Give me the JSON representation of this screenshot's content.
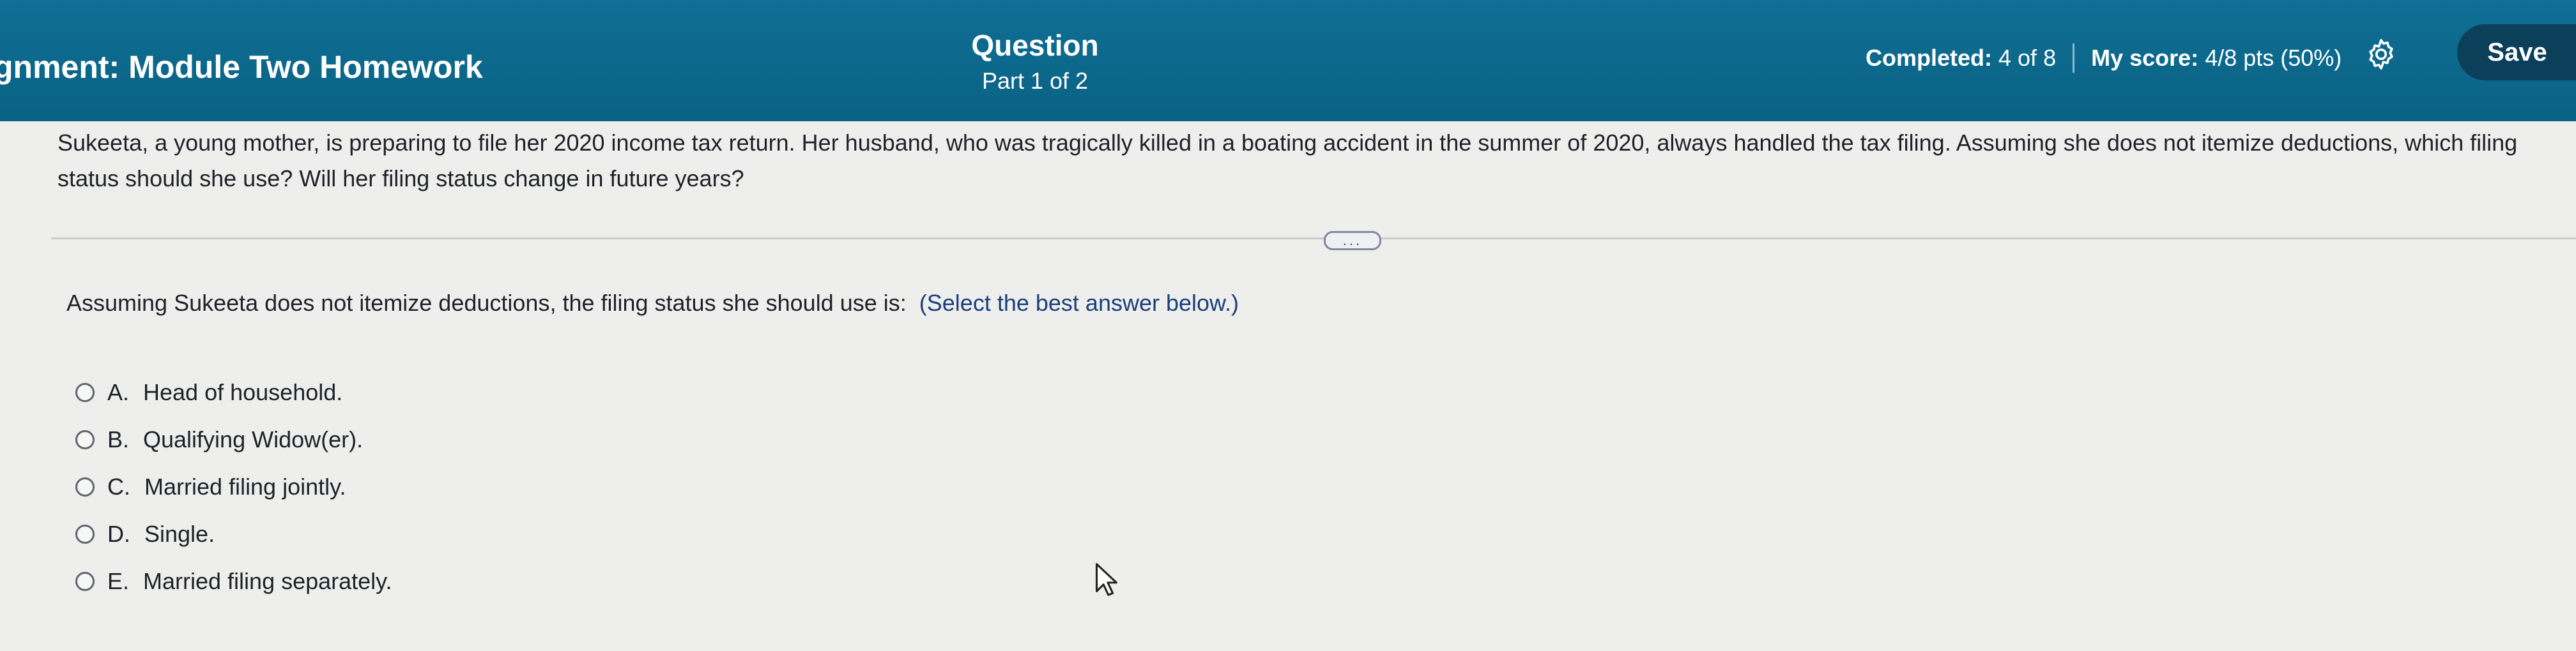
{
  "header": {
    "assignment_title": "gnment: Module Two Homework",
    "question_label": "Question",
    "part_label": "Part 1 of 2",
    "completed_label": "Completed:",
    "completed_value": "4 of 8",
    "score_label": "My score:",
    "score_value": "4/8 pts (50%)",
    "save_label": "Save"
  },
  "question": {
    "text": "Sukeeta, a young mother, is preparing to file her 2020 income tax return. Her husband, who was tragically killed in a boating accident in the summer of 2020, always handled the tax filing. Assuming she does not itemize deductions, which filing status should she use? Will her filing status change in future years?"
  },
  "expand": {
    "label": "..."
  },
  "prompt": {
    "text": "Assuming Sukeeta does not itemize deductions, the filing status she should use is:",
    "hint": "(Select the best answer below.)"
  },
  "options": [
    {
      "letter": "A.",
      "label": "Head of household."
    },
    {
      "letter": "B.",
      "label": "Qualifying Widow(er)."
    },
    {
      "letter": "C.",
      "label": "Married filing jointly."
    },
    {
      "letter": "D.",
      "label": "Single."
    },
    {
      "letter": "E.",
      "label": "Married filing separately."
    }
  ],
  "colors": {
    "header_bg": "#0f6f94",
    "save_bg": "#0b3f5a",
    "page_bg": "#eeeeec",
    "hint_text": "#1a3f7a"
  },
  "icons": {
    "settings": "gear-icon",
    "cursor": "mouse-pointer-icon"
  }
}
